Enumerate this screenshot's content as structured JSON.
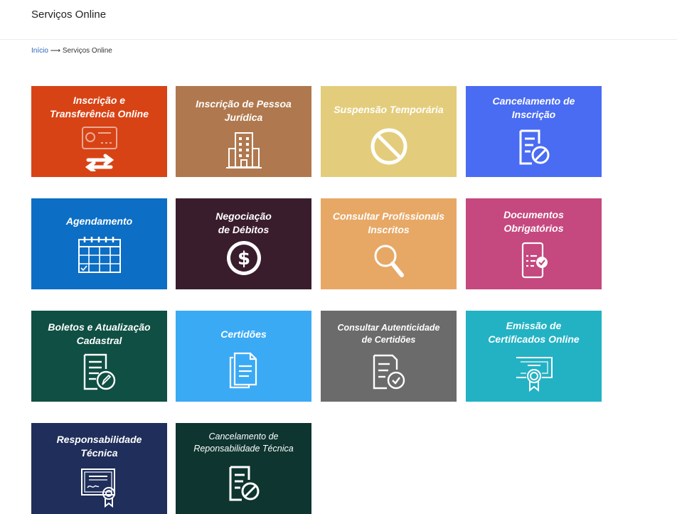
{
  "header": {
    "title": "Serviços Online"
  },
  "breadcrumb": {
    "home": "Início",
    "separator": "⟶",
    "current": "Serviços Online"
  },
  "tiles": [
    {
      "label": "Inscrição e\nTransferência Online",
      "color": "#d84315",
      "icon": "id-card-transfer-icon"
    },
    {
      "label": "Inscrição de Pessoa\nJurídica",
      "color": "#b0784e",
      "icon": "building-icon"
    },
    {
      "label": "Suspensão Temporária",
      "color": "#e3cd7c",
      "icon": "prohibited-icon"
    },
    {
      "label": "Cancelamento de\nInscrição",
      "color": "#4a6cf2",
      "icon": "cancel-document-icon"
    },
    {
      "label": "Agendamento",
      "color": "#0c6ec4",
      "icon": "calendar-icon"
    },
    {
      "label": "Negociação\nde Débitos",
      "color": "#3a1d2c",
      "icon": "dollar-coin-icon"
    },
    {
      "label": "Consultar Profissionais\nInscritos",
      "color": "#e7a866",
      "icon": "magnifier-icon"
    },
    {
      "label": "Documentos\nObrigatórios",
      "color": "#c5487f",
      "icon": "mobile-checklist-icon"
    },
    {
      "label": "Boletos e Atualização\nCadastral",
      "color": "#0f4f44",
      "icon": "document-edit-icon"
    },
    {
      "label": "Certidões",
      "color": "#3aaaf5",
      "icon": "documents-icon"
    },
    {
      "label": "Consultar Autenticidade\nde Certidões",
      "color": "#6b6b6b",
      "icon": "document-check-icon"
    },
    {
      "label": "Emissão de\nCertificados Online",
      "color": "#22b2c4",
      "icon": "certificate-icon"
    },
    {
      "label": "Responsabilidade\nTécnica",
      "color": "#1f2e5a",
      "icon": "diploma-icon"
    },
    {
      "label": "Cancelamento de\nReponsabilidade Técnica",
      "color": "#0e3530",
      "icon": "cancel-document-icon"
    }
  ]
}
